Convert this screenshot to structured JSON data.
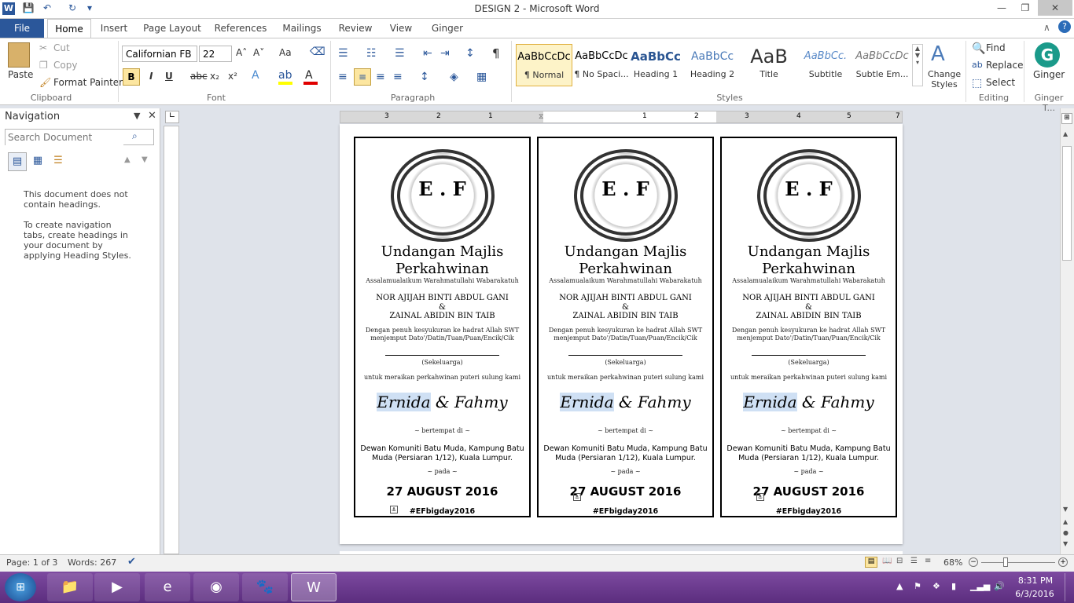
{
  "app": {
    "title": "DESIGN 2  -  Microsoft Word",
    "logo": "W"
  },
  "window_controls": {
    "minimize": "—",
    "restore": "❐",
    "close": "✕"
  },
  "tabs": [
    "File",
    "Home",
    "Insert",
    "Page Layout",
    "References",
    "Mailings",
    "Review",
    "View",
    "Ginger"
  ],
  "clipboard": {
    "paste": "Paste",
    "cut": "Cut",
    "copy": "Copy",
    "format_painter": "Format Painter",
    "group": "Clipboard"
  },
  "font": {
    "family": "Californian FB",
    "size": "22",
    "group": "Font",
    "bold": "B",
    "italic": "I",
    "underline": "U",
    "strike": "abc",
    "sub": "x₂",
    "sup": "x²",
    "grow": "A˄",
    "shrink": "A˅",
    "case": "Aa",
    "highlight_color": "#ffff00",
    "font_color": "#e00000"
  },
  "paragraph": {
    "group": "Paragraph",
    "pilcrow": "¶"
  },
  "styles": {
    "group": "Styles",
    "items": [
      {
        "preview": "AaBbCcDc",
        "name": "¶ Normal"
      },
      {
        "preview": "AaBbCcDc",
        "name": "¶ No Spaci..."
      },
      {
        "preview": "AaBbCc",
        "name": "Heading 1"
      },
      {
        "preview": "AaBbCc",
        "name": "Heading 2"
      },
      {
        "preview": "AaB",
        "name": "Title"
      },
      {
        "preview": "AaBbCc.",
        "name": "Subtitle"
      },
      {
        "preview": "AaBbCcDc",
        "name": "Subtle Em..."
      }
    ],
    "change_styles": "Change Styles"
  },
  "editing": {
    "group": "Editing",
    "find": "Find",
    "replace": "Replace",
    "select": "Select"
  },
  "ginger": {
    "label": "Ginger",
    "group": "Ginger T..."
  },
  "navigation": {
    "title": "Navigation",
    "search_placeholder": "Search Document",
    "msg1": "This document does not contain headings.",
    "msg2": "To create navigation tabs, create headings in your document by applying Heading Styles."
  },
  "ruler_numbers": [
    "3",
    "2",
    "1",
    "1",
    "2",
    "3",
    "4",
    "5",
    "6",
    "7"
  ],
  "card": {
    "initials": "E . F",
    "title": "Undangan  Majlis Perkahwinan",
    "salam": "Assalamualaikum   Warahmatullahi   Wabarakatuh",
    "name1": "NOR AJIJAH BINTI ABDUL GANI",
    "amp": "&",
    "name2": "ZAINAL ABIDIN BIN TAIB",
    "invite": "Dengan penuh kesyukuran  ke hadrat Allah SWT menjemput Dato'/Datin/Tuan/Puan/Encik/Cik",
    "family": "(Sekeluarga)",
    "purpose": "untuk meraikan perkahwinan  puteri sulung kami",
    "bride": "Ernida",
    "and": "&",
    "groom": "Fahmy",
    "at": "~ bertempat di ~",
    "location": "Dewan Komuniti Batu Muda, Kampung Batu Muda (Persiaran 1/12), Kuala Lumpur.",
    "on": "~ pada ~",
    "date": "27 AUGUST 2016",
    "hashtag": "#EFbigday2016"
  },
  "status": {
    "page": "Page: 1 of 3",
    "words": "Words: 267",
    "zoom": "68%"
  },
  "clock": {
    "time": "8:31 PM",
    "date": "6/3/2016"
  }
}
